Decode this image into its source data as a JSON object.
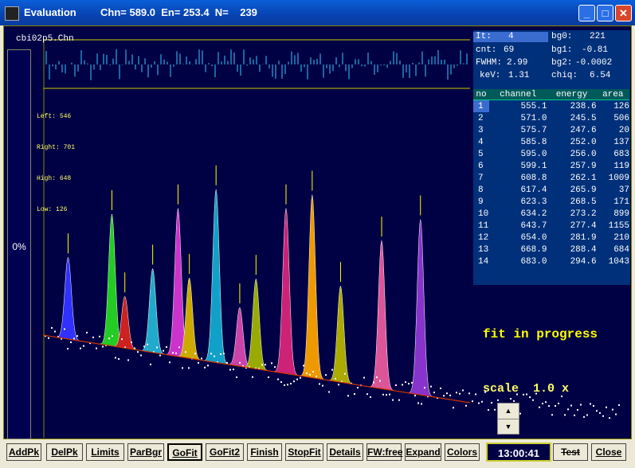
{
  "window": {
    "title": "Evaluation",
    "readout": "Chn= 589.0  En= 253.4  N=    239",
    "minimize_label": "_",
    "maximize_label": "□",
    "close_label": "✕"
  },
  "spectrum": {
    "name": "cbi02p5.Chn",
    "limits": {
      "left_label": "Left:",
      "left": "546",
      "right_label": "Right:",
      "right": "701",
      "high_label": "High:",
      "high": "648",
      "low_label": "Low:",
      "low": "126"
    }
  },
  "sidebar": {
    "percent": "0%"
  },
  "fit_info": {
    "it_label": "It:",
    "it": "4",
    "bg0_label": "bg0:",
    "bg0": "221",
    "cnt_label": "cnt:",
    "cnt": "69",
    "bg1_label": "bg1:",
    "bg1": "-0.81",
    "fwhm_label": "FWHM:",
    "fwhm": "2.99",
    "bg2_label": "bg2:",
    "bg2": "-0.0002",
    "kev_label": "keV:",
    "kev": "1.31",
    "chiq_label": "chiq:",
    "chiq": "6.54"
  },
  "peak_table": {
    "headers": [
      "no",
      "channel",
      "energy",
      "area"
    ],
    "selected": 1,
    "rows": [
      [
        "1",
        "555.1",
        "238.6",
        "126"
      ],
      [
        "2",
        "571.0",
        "245.5",
        "506"
      ],
      [
        "3",
        "575.7",
        "247.6",
        "20"
      ],
      [
        "4",
        "585.8",
        "252.0",
        "137"
      ],
      [
        "5",
        "595.0",
        "256.0",
        "683"
      ],
      [
        "6",
        "599.1",
        "257.9",
        "119"
      ],
      [
        "7",
        "608.8",
        "262.1",
        "1009"
      ],
      [
        "8",
        "617.4",
        "265.9",
        "37"
      ],
      [
        "9",
        "623.3",
        "268.5",
        "171"
      ],
      [
        "10",
        "634.2",
        "273.2",
        "899"
      ],
      [
        "11",
        "643.7",
        "277.4",
        "1155"
      ],
      [
        "12",
        "654.0",
        "281.9",
        "210"
      ],
      [
        "13",
        "668.9",
        "288.4",
        "684"
      ],
      [
        "14",
        "683.0",
        "294.6",
        "1043"
      ]
    ]
  },
  "status_text": "fit in progress",
  "scale_text": "scale  1.0 x",
  "spinner": {
    "up": "▲",
    "down": "▼"
  },
  "toolbar": {
    "buttons": [
      "AddPk",
      "DelPk",
      "Limits",
      "ParBgr",
      "GoFit",
      "GoFit2",
      "Finish",
      "StopFit",
      "Details",
      "FW:free",
      "Expand",
      "Colors",
      "Test",
      "Close"
    ],
    "time": "13:00:41"
  },
  "chart_data": {
    "type": "area",
    "x_label": "",
    "y_label": "",
    "channel_range": [
      546,
      701
    ],
    "peaks": [
      {
        "channel": 555.1,
        "color": "#3030FF"
      },
      {
        "channel": 571.0,
        "color": "#22CC22"
      },
      {
        "channel": 575.7,
        "color": "#CC2222"
      },
      {
        "channel": 585.8,
        "color": "#22AACC"
      },
      {
        "channel": 595.0,
        "color": "#CC33CC"
      },
      {
        "channel": 599.1,
        "color": "#CCAA00"
      },
      {
        "channel": 608.8,
        "color": "#11A0C8"
      },
      {
        "channel": 617.4,
        "color": "#CC44AA"
      },
      {
        "channel": 623.3,
        "color": "#99AA00"
      },
      {
        "channel": 634.2,
        "color": "#CC2277"
      },
      {
        "channel": 643.7,
        "color": "#EE9900"
      },
      {
        "channel": 654.0,
        "color": "#AAAA00"
      },
      {
        "channel": 668.9,
        "color": "#DD5599"
      },
      {
        "channel": 683.0,
        "color": "#8833CC"
      }
    ]
  }
}
